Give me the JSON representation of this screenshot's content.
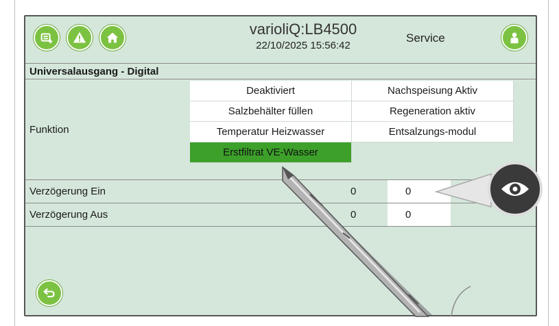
{
  "header": {
    "title": "varioliQ:LB4500",
    "datetime": "22/10/2025 15:56:42",
    "mode": "Service",
    "icons": [
      "list-add-icon",
      "warning-icon",
      "home-icon",
      "user-icon"
    ]
  },
  "section_title": "Universalausgang - Digital",
  "funktion": {
    "label": "Funktion",
    "options": [
      {
        "label": "Deaktiviert",
        "selected": false
      },
      {
        "label": "Nachspeisung Aktiv",
        "selected": false
      },
      {
        "label": "Salzbehälter füllen",
        "selected": false
      },
      {
        "label": "Regeneration aktiv",
        "selected": false
      },
      {
        "label": "Temperatur Heizwasser",
        "selected": false
      },
      {
        "label": "Entsalzungs-modul",
        "selected": false
      },
      {
        "label": "Erstfiltrat VE-Wasser",
        "selected": true
      }
    ]
  },
  "rows": [
    {
      "label": "Verzögerung Ein",
      "current": "0",
      "value": "0"
    },
    {
      "label": "Verzögerung Aus",
      "current": "0",
      "value": "0"
    }
  ],
  "colors": {
    "accent": "#7cc242",
    "selected": "#3ca02a",
    "background": "#d5e7db"
  },
  "overlay": {
    "icons": [
      "eye-icon",
      "stylus-pen"
    ]
  }
}
